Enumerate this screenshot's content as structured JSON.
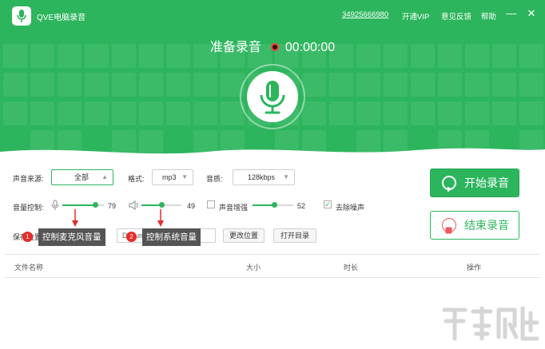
{
  "app": {
    "title": "QVE电脑录音",
    "user_id": "34925666980",
    "links": [
      "开通VIP",
      "意见反馈",
      "帮助"
    ],
    "window_controls": [
      "minimize-icon",
      "close-icon"
    ]
  },
  "recorder": {
    "status": "准备录音",
    "timer": "00:00:00"
  },
  "settings": {
    "source_label": "声音来源:",
    "source_value": "全部",
    "format_label": "格式:",
    "format_value": "mp3",
    "quality_label": "音质:",
    "quality_value": "128kbps",
    "volume_label": "音量控制:",
    "mic_volume": 79,
    "system_volume": 49,
    "boost_label": "声音增强",
    "boost_value": 52,
    "boost_checked": false,
    "denoise_label": "去除噪声",
    "denoise_checked": true,
    "save_label": "保存位置",
    "save_path": "Documents",
    "change_location": "更改位置",
    "open_folder": "打开目录"
  },
  "actions": {
    "start": "开始录音",
    "stop": "结束录音"
  },
  "annotations": [
    {
      "badge": "1",
      "text": "控制麦克风音量"
    },
    {
      "badge": "2",
      "text": "控制系统音量"
    }
  ],
  "table": {
    "columns": [
      "文件名称",
      "大小",
      "时长",
      "操作"
    ]
  },
  "colors": {
    "brand_green": "#2db55d",
    "record_red": "#ff3b3b",
    "badge_red": "#e82a2a"
  }
}
